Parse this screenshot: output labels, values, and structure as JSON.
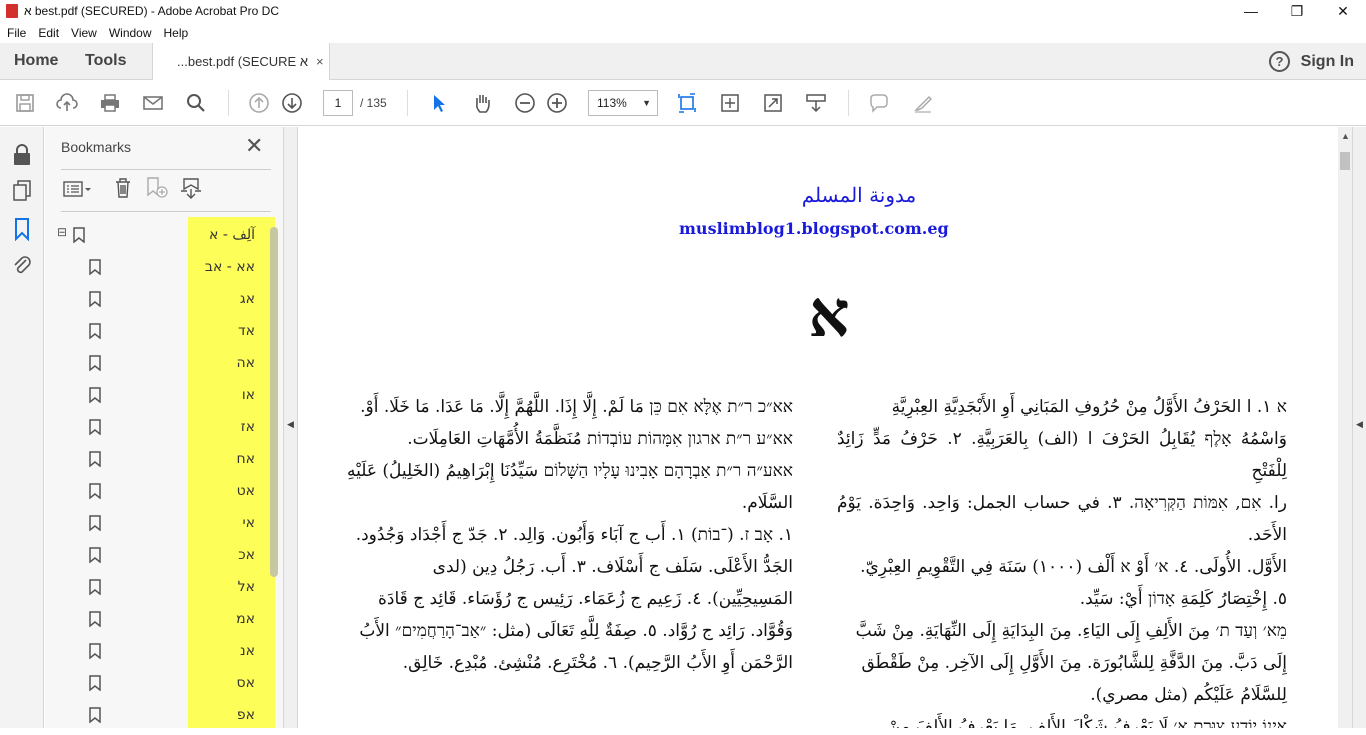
{
  "window": {
    "title": "א best.pdf (SECURED) - Adobe Acrobat Pro DC",
    "controls": [
      "—",
      "❐",
      "✕"
    ]
  },
  "menu": [
    "File",
    "Edit",
    "View",
    "Window",
    "Help"
  ],
  "tabs": {
    "home": "Home",
    "tools": "Tools",
    "document": "...best.pdf (SECURE א",
    "close": "×",
    "help": "?",
    "signin": "Sign In"
  },
  "toolbar": {
    "page_current": "1",
    "page_total": "/  135",
    "zoom": "113%"
  },
  "bookmarks": {
    "title": "Bookmarks",
    "close": "✕",
    "expander": "⊟",
    "items": [
      "آلِف - א",
      "אא - אב",
      "אג",
      "אד",
      "אה",
      "או",
      "אז",
      "אח",
      "אט",
      "אי",
      "אכ",
      "אל",
      "אמ",
      "אנ",
      "אס",
      "אפ"
    ]
  },
  "document": {
    "blog_name": "مدونة المسلم",
    "blog_url": "muslimblog1.blogspot.com.eg",
    "letter": "א",
    "right_column": [
      "א ١. ا الحَرْفُ الأَوَّلُ مِنْ حُرُوفِ المَبَانِي أَوِ الأَبْجَدِيَّةِ العِبْرِيَّةِ",
      "وَاسْمُهُ אָלֶף يُقَابِلُ الحَرْفَ ا (الف) بِالعَرَبِيَّةِ. ٢. حَرْفُ مَدٍّ زَائِدٌ لِلْفَتْحِ",
      "را. אִם, אִמּוֹת הַקְּרִיאָה. ٣. في حساب الجمل: وَاحِد. وَاحِدَة. يَوْمُ الأَحَد.",
      "الأَوَّل. الأُولَى. ٤. א׳ أَوْ א أَلْف (١٠٠٠) سَنَة فِي التَّقْوِيمِ العِبْرِيّ.",
      "٥. إِخْتِصَارُ كَلِمَةِ אָדוֹן أَيْ: سَيِّد.",
      "מֵא׳ וְעַד ת׳ مِنَ الأَلِفِ إِلَى اليَاءِ. مِنَ البِدَايَةِ إِلَى النِّهَايَةِ. مِنْ شَبَّ",
      "إِلَى دَبَّ. مِنَ الدَّفَّةِ لِلشَّابُورَة. مِنَ الأَوَّلِ إِلَى الآخِر. مِنْ طَقْطَق",
      "لِلسَّلَامُ عَلَيْكُم (مثل مصري).",
      "אֵינוֹ יוֹדֵעַ צוּרַת א׳ لَا يَعْرِفُ شَكْلَ الأَلِفِ. مَا يَعْرِفُ الأَلِفَ مِنْ"
    ],
    "left_column": [
      "אא״כ ר״ת אֶלָּא אִם כֵּן مَا لَمْ. إِلَّا إِذَا. اللَّهُمَّ إِلَّا. مَا عَدَا. مَا خَلَا. أَوْ.",
      "אא״ע ר״ת ארגון אִמָּהוֹת עוֹבְדוֹת مُنَظَّمَةُ الأُمَّهَاتِ العَامِلَات.",
      "אאע״ה ר״ת אַבְרָהָם אָבִינוּ עָלָיו הַשָּׁלוֹם سَيِّدُنَا إِبْرَاهِيمُ (الخَلِيلُ) عَلَيْهِ",
      "السَّلَام.",
      "١. אָב ז. (־בוֹת) ١. أَب ج آبَاء وَأَبُون. وَالِد. ٢. جَدّ ج أَجْدَاد وَجُدُود.",
      "الجَدُّ الأَعْلَى. سَلَف ج أَسْلَاف. ٣. أَب. رَجُلُ دِين (لدى",
      "المَسِيحِيِّين). ٤. زَعِيم ج زُعَمَاء. رَئِيس ج رُؤَسَاء. قَائِد ج قَادَة",
      "وَقُوَّاد. رَائِد ج رُوَّاد. ٥. صِفَةٌ لِلَّهِ تَعَالَى (مثل: ״אַב־הָרַחֲמִים״ الأَبُ",
      "الرَّحْمَن أَوِ الأَبُ الرَّحِيم). ٦. مُخْتَرِع. مُنْشِئ. مُبْدِع. خَالِق."
    ]
  },
  "colors": {
    "highlight": "#fefe58",
    "link_blue": "#1a1adc",
    "accent_blue": "#1473e6",
    "pdf_red": "#d32f2f"
  }
}
